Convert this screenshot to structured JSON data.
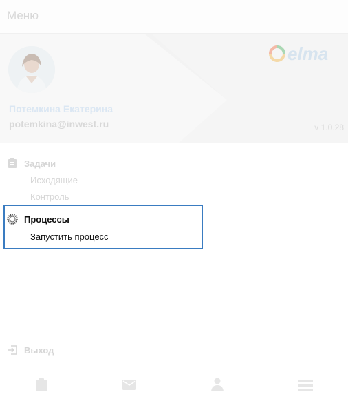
{
  "header": {
    "title": "Меню"
  },
  "profile": {
    "name": "Потемкина Екатерина",
    "email": "potemkina@inwest.ru",
    "version": "v 1.0.28",
    "logo_text": "elma"
  },
  "menu": {
    "tasks": {
      "label": "Задачи",
      "items": [
        "Исходящие",
        "Контроль"
      ]
    },
    "processes": {
      "label": "Процессы",
      "items": [
        "Запустить процесс"
      ]
    },
    "exit": {
      "label": "Выход"
    }
  },
  "bottom_nav": {
    "icons": [
      "tasks-icon",
      "mail-icon",
      "user-icon",
      "menu-icon"
    ]
  },
  "colors": {
    "highlight_border": "#3a7cc1",
    "faded_text": "#d6d6d6",
    "active_text": "#111111"
  }
}
